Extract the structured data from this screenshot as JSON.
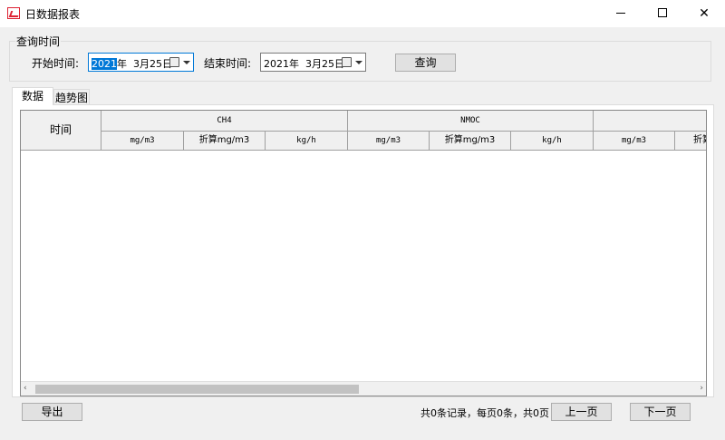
{
  "window": {
    "title": "日数据报表"
  },
  "query": {
    "group_title": "查询时间",
    "start_label": "开始时间:",
    "start_value_selected": "2021",
    "start_value_rest": "年  3月25日",
    "end_label": "结束时间:",
    "end_value": "2021年  3月25日",
    "query_button": "查询"
  },
  "tabs": [
    {
      "label": "数据"
    },
    {
      "label": "趋势图"
    }
  ],
  "grid": {
    "time_header": "时间",
    "groups": [
      {
        "name": "CH4",
        "subs": [
          "mg/m3",
          "折算mg/m3",
          "kg/h"
        ]
      },
      {
        "name": "NMOC",
        "subs": [
          "mg/m3",
          "折算mg/m3",
          "kg/h"
        ]
      },
      {
        "name": "",
        "subs": [
          "mg/m3",
          "折算"
        ]
      }
    ],
    "scroll_left": "‹",
    "scroll_right": "›"
  },
  "footer": {
    "export_button": "导出",
    "pager_text": "共0条记录，每页0条，共0页",
    "prev_button": "上一页",
    "next_button": "下一页"
  }
}
